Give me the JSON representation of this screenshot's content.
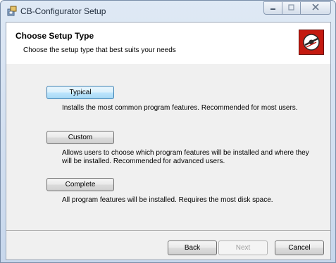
{
  "window": {
    "title": "CB-Configurator Setup",
    "icons": {
      "app": "installer-icon",
      "minimize": "minimize-icon",
      "maximize": "maximize-icon",
      "close": "close-icon"
    }
  },
  "header": {
    "title": "Choose Setup Type",
    "subtitle": "Choose the setup type that best suits your needs",
    "logo_icon": "disc-logo-icon"
  },
  "options": [
    {
      "label": "Typical",
      "description": "Installs the most common program features. Recommended for most users.",
      "focused": true
    },
    {
      "label": "Custom",
      "description": "Allows users to choose which program features will be installed and where they will be installed. Recommended for advanced users.",
      "focused": false
    },
    {
      "label": "Complete",
      "description": "All program features will be installed. Requires the most disk space.",
      "focused": false
    }
  ],
  "footer": {
    "back_label": "Back",
    "next_label": "Next",
    "cancel_label": "Cancel"
  },
  "colors": {
    "accent": "#c41a10",
    "focus_border": "#3c7fb1"
  }
}
